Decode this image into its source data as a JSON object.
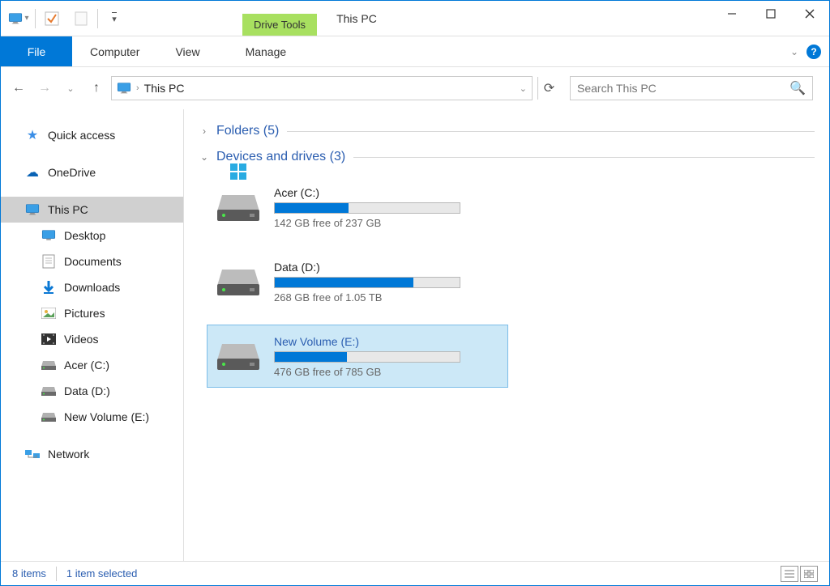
{
  "title": "This PC",
  "context_tab": "Drive Tools",
  "ribbon": {
    "file": "File",
    "tabs": [
      "Computer",
      "View"
    ],
    "context_tab": "Manage"
  },
  "address": {
    "location": "This PC"
  },
  "search": {
    "placeholder": "Search This PC"
  },
  "sidebar": {
    "quick_access": "Quick access",
    "onedrive": "OneDrive",
    "this_pc": "This PC",
    "children": [
      {
        "label": "Desktop",
        "icon": "desktop"
      },
      {
        "label": "Documents",
        "icon": "document"
      },
      {
        "label": "Downloads",
        "icon": "download"
      },
      {
        "label": "Pictures",
        "icon": "picture"
      },
      {
        "label": "Videos",
        "icon": "video"
      },
      {
        "label": "Acer (C:)",
        "icon": "drive"
      },
      {
        "label": "Data (D:)",
        "icon": "drive"
      },
      {
        "label": "New Volume (E:)",
        "icon": "drive"
      }
    ],
    "network": "Network"
  },
  "groups": {
    "folders": {
      "label": "Folders",
      "count": 5,
      "expanded": false
    },
    "drives": {
      "label": "Devices and drives",
      "count": 3,
      "expanded": true
    }
  },
  "drives": [
    {
      "name": "Acer (C:)",
      "free": "142 GB free of 237 GB",
      "pct": 40,
      "selected": false,
      "os": true
    },
    {
      "name": "Data (D:)",
      "free": "268 GB free of 1.05 TB",
      "pct": 75,
      "selected": false,
      "os": false
    },
    {
      "name": "New Volume (E:)",
      "free": "476 GB free of 785 GB",
      "pct": 39,
      "selected": true,
      "os": false
    }
  ],
  "status": {
    "items": "8 items",
    "selected": "1 item selected"
  }
}
